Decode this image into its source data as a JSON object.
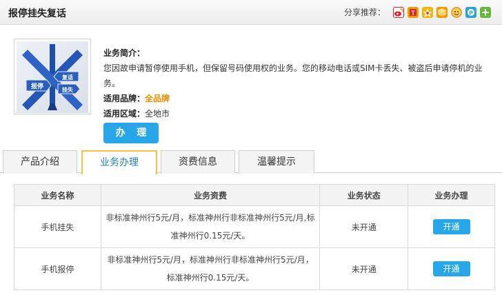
{
  "header": {
    "title": "报停挂失复话",
    "share_label": "分享推荐："
  },
  "share_icons": [
    {
      "name": "weibo-icon",
      "color": "#e6162d"
    },
    {
      "name": "tencent-weibo-icon",
      "color": "#e8a300"
    },
    {
      "name": "qzone-icon",
      "color": "#f5b400"
    },
    {
      "name": "renren-icon",
      "color": "#f39800"
    },
    {
      "name": "kaixin-icon",
      "color": "#e9a23b"
    },
    {
      "name": "douban-icon",
      "color": "#2fa3d7"
    },
    {
      "name": "more-share-icon",
      "color": "#64b83a"
    }
  ],
  "intro": {
    "heading": "业务简介：",
    "description": "您因故申请暂停使用手机，但保留号码使用权的业务。您的移动电话或SIM卡丢失、被盗后申请停机的业务。",
    "brand_label": "适用品牌：",
    "brand_value": "全品牌",
    "region_label": "适用区域：",
    "region_value": "全地市",
    "handle_button": "办 理"
  },
  "product_image": {
    "sign_left": "报停",
    "sign_right_top": "复话",
    "sign_right_bottom": "挂失"
  },
  "tabs": [
    {
      "label": "产品介绍",
      "active": false
    },
    {
      "label": "业务办理",
      "active": true
    },
    {
      "label": "资费信息",
      "active": false
    },
    {
      "label": "温馨提示",
      "active": false
    }
  ],
  "table": {
    "headers": [
      "业务名称",
      "业务资费",
      "业务状态",
      "业务办理"
    ],
    "rows": [
      {
        "name": "手机挂失",
        "fee_line1": "非标准神州行5元/月，标准神州行非标准神州行5元/月,标",
        "fee_line2": "准神州行0.15元/天。",
        "status": "未开通",
        "action": "开通"
      },
      {
        "name": "手机报停",
        "fee_line1": "非标准神州行5元/月，标准神州行非标准神州行5元/月，",
        "fee_line2": "标准神州行0.15元/天。",
        "status": "未开通",
        "action": "开通"
      }
    ]
  },
  "colors": {
    "accent_blue": "#27a7ea",
    "brand_orange": "#f08c00",
    "active_tab_border": "#f5c343"
  }
}
